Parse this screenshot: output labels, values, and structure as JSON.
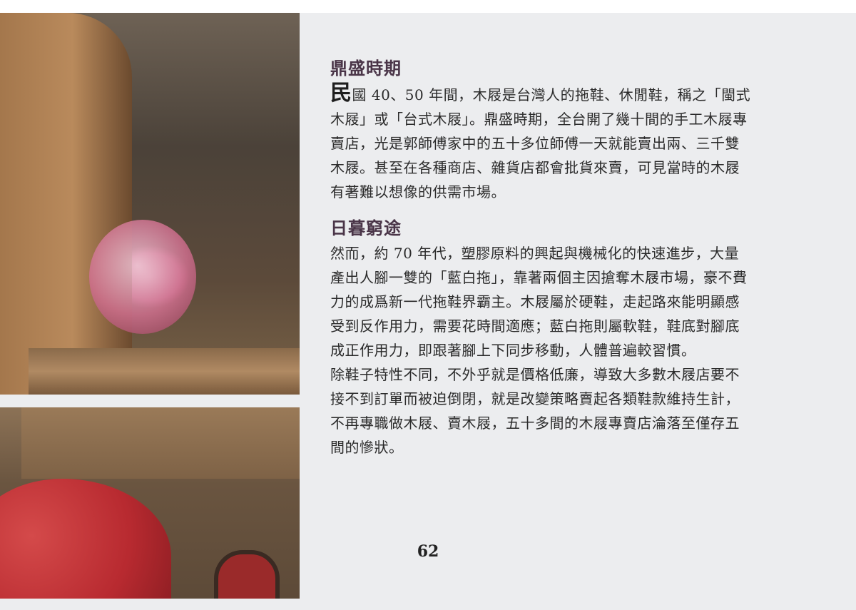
{
  "section1": {
    "heading": "鼎盛時期",
    "dropcap": "民",
    "lines": [
      "國 40、50 年間，木屐是台灣人的拖鞋、休閒鞋，稱之「閩式",
      "木屐」或「台式木屐」。鼎盛時期，全台開了幾十間的手工木屐專",
      "賣店，光是郭師傅家中的五十多位師傅一天就能賣出兩、三千雙",
      "木屐。甚至在各種商店、雜貨店都會批貨來賣，可見當時的木屐",
      "有著難以想像的供需市場。"
    ]
  },
  "section2": {
    "heading": "日暮窮途",
    "lines": [
      "然而，約 70 年代，塑膠原料的興起與機械化的快速進步，大量",
      "產出人腳一雙的「藍白拖」，靠著兩個主因搶奪木屐市場，豪不費",
      "力的成爲新一代拖鞋界霸主。木屐屬於硬鞋，走起路來能明顯感",
      "受到反作用力，需要花時間適應；藍白拖則屬軟鞋，鞋底對腳底",
      "成正作用力，即跟著腳上下同步移動，人體普遍較習慣。",
      "除鞋子特性不同，不外乎就是價格低廉，導致大多數木屐店要不",
      "接不到訂單而被迫倒閉，就是改變策略賣起各類鞋款維持生計，",
      "不再專職做木屐、賣木屐，五十多間的木屐專賣店淪落至僅存五",
      "間的慘狀。"
    ]
  },
  "page_number": "62"
}
